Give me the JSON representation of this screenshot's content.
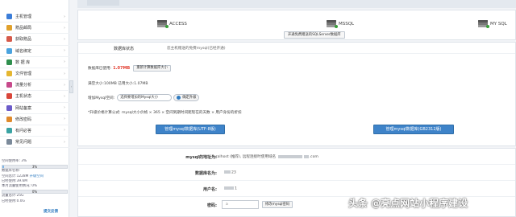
{
  "colors": {
    "accent": "#3e83c9",
    "usage_red": "#e23b2e",
    "sidebar_bg": "#ffffff",
    "page_bg": "#f2f4f7"
  },
  "sidebar": {
    "items": [
      {
        "label": "主机管理",
        "icon": "server-icon",
        "color": "#3b7dd8"
      },
      {
        "label": "赠品邮局",
        "icon": "mail-icon",
        "color": "#e0a02b"
      },
      {
        "label": "获取赠品",
        "icon": "gift-icon",
        "color": "#d65a4a"
      },
      {
        "label": "域名绑定",
        "icon": "globe-icon",
        "color": "#4aa3df"
      },
      {
        "label": "数 据 库",
        "icon": "database-icon",
        "color": "#2f8f4e"
      },
      {
        "label": "文件管理",
        "icon": "folder-icon",
        "color": "#e5b630"
      },
      {
        "label": "流量分析",
        "icon": "chart-icon",
        "color": "#c74a8b"
      },
      {
        "label": "主机状态",
        "icon": "status-icon",
        "color": "#d9463a"
      },
      {
        "label": "网站备案",
        "icon": "record-icon",
        "color": "#6b5bc9"
      },
      {
        "label": "修改密码",
        "icon": "key-icon",
        "color": "#e08a2b"
      },
      {
        "label": "有问必答",
        "icon": "question-icon",
        "color": "#3aa3a3"
      },
      {
        "label": "常见问题",
        "icon": "faq-icon",
        "color": "#7b8a9a"
      }
    ],
    "stats": {
      "space_used_label": "空间使用率: 3%",
      "space_bar_text": "3%",
      "space_pct": 3,
      "db_label": "数据库名称:",
      "quota_line": "空间总计:1228M",
      "upgrade_link": "升级空间",
      "used_line": "已经使用:39.6M",
      "traffic_label": "本月流量使用情况: 0%",
      "traffic_bar_text": "0%",
      "traffic_pct": 0,
      "traffic_total": "流量总计:25G",
      "traffic_used": "已经使用:0.0G",
      "help_label": "提交反馈"
    }
  },
  "db_types": {
    "access": "ACCESS",
    "mssql": "MSSQL",
    "mysql": "MY SQL",
    "open_mssql_button": "开通免费赠送的SQLServer数据库"
  },
  "db_panel": {
    "status_label": "数据库状态",
    "status_value": "您主机赠送的免费mysql(已经开通)",
    "usage_prefix": "数据库已使用:",
    "usage_value": "1.07MB",
    "recalc_button": "重新计算数据库大小",
    "size_line": "满空大小:100MB  已用大小:1.07MB",
    "increase_label": "增加Mysql空间:",
    "select_value": "选择要增加的Mysql大小",
    "confirm_button": "确定升级",
    "price_note": "*升级价格计算公式: mysql大小价格 × 365 × 空间到期时间距现在的天数 × 用户身份的折扣",
    "manage_button_1": "管理mysql数据库(UTF-8版)",
    "manage_button_2": "管理mysql数据库(GB2312版)"
  },
  "info": {
    "address_label": "mysql的地址为:",
    "address_value": "localhost (推荐),  远程连接时使用域名",
    "address_suffix": ".com",
    "dbname_label": "数据库名为:",
    "dbname_value": "23",
    "user_label": "用户名:",
    "user_value": "1",
    "password_label": "密码:",
    "password_value": "a",
    "password_button": "修改mysql密码"
  },
  "watermark": "头条 @亮点网站小程序建设"
}
